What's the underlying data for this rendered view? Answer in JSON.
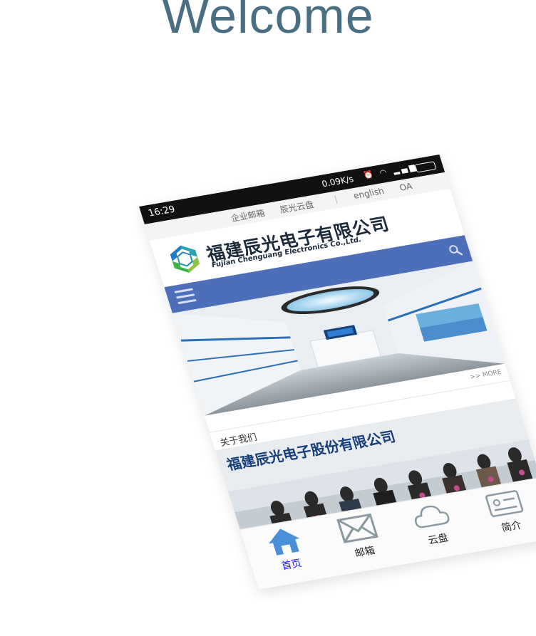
{
  "heading": "Welcome",
  "status_bar": {
    "time": "16:29",
    "net_speed": "0.09K/s",
    "icons": [
      "alarm-icon",
      "wifi-icon",
      "signal-icon",
      "battery-icon"
    ]
  },
  "top_nav": {
    "items": [
      "企业邮箱",
      "辰光云盘"
    ],
    "lang": "english",
    "oa": "OA"
  },
  "brand": {
    "name_cn": "福建辰光电子有限公司",
    "name_en": "Fujian Chenguang Electronics Co.,Ltd."
  },
  "search": {
    "icon": "search-icon"
  },
  "menu": {
    "icon": "menu-icon"
  },
  "more_link": ">> MORE",
  "about": {
    "title": "关于我们"
  },
  "photo": {
    "banner_text": "福建辰光电子股份有限公司"
  },
  "tabbar": {
    "items": [
      {
        "label": "首页",
        "icon": "home-icon",
        "active": true
      },
      {
        "label": "邮箱",
        "icon": "mail-icon",
        "active": false
      },
      {
        "label": "云盘",
        "icon": "cloud-icon",
        "active": false
      },
      {
        "label": "简介",
        "icon": "id-card-icon",
        "active": false
      }
    ]
  },
  "colors": {
    "accent": "#4d6fb9",
    "heading": "#4a6f82",
    "active_tab": "#1a1aff",
    "home_icon": "#4a90d9"
  }
}
